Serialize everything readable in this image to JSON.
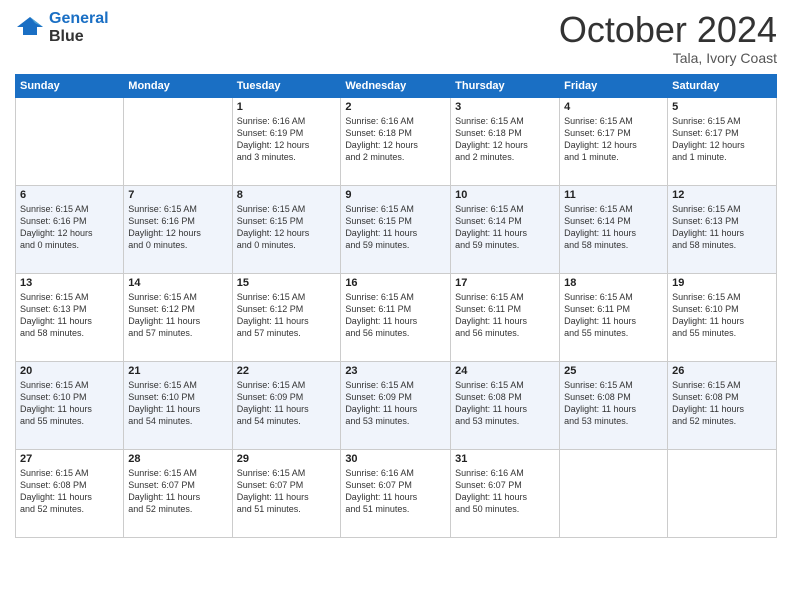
{
  "logo": {
    "line1": "General",
    "line2": "Blue"
  },
  "title": {
    "month_year": "October 2024",
    "location": "Tala, Ivory Coast"
  },
  "days_of_week": [
    "Sunday",
    "Monday",
    "Tuesday",
    "Wednesday",
    "Thursday",
    "Friday",
    "Saturday"
  ],
  "weeks": [
    [
      {
        "day": "",
        "info": ""
      },
      {
        "day": "",
        "info": ""
      },
      {
        "day": "1",
        "info": "Sunrise: 6:16 AM\nSunset: 6:19 PM\nDaylight: 12 hours\nand 3 minutes."
      },
      {
        "day": "2",
        "info": "Sunrise: 6:16 AM\nSunset: 6:18 PM\nDaylight: 12 hours\nand 2 minutes."
      },
      {
        "day": "3",
        "info": "Sunrise: 6:15 AM\nSunset: 6:18 PM\nDaylight: 12 hours\nand 2 minutes."
      },
      {
        "day": "4",
        "info": "Sunrise: 6:15 AM\nSunset: 6:17 PM\nDaylight: 12 hours\nand 1 minute."
      },
      {
        "day": "5",
        "info": "Sunrise: 6:15 AM\nSunset: 6:17 PM\nDaylight: 12 hours\nand 1 minute."
      }
    ],
    [
      {
        "day": "6",
        "info": "Sunrise: 6:15 AM\nSunset: 6:16 PM\nDaylight: 12 hours\nand 0 minutes."
      },
      {
        "day": "7",
        "info": "Sunrise: 6:15 AM\nSunset: 6:16 PM\nDaylight: 12 hours\nand 0 minutes."
      },
      {
        "day": "8",
        "info": "Sunrise: 6:15 AM\nSunset: 6:15 PM\nDaylight: 12 hours\nand 0 minutes."
      },
      {
        "day": "9",
        "info": "Sunrise: 6:15 AM\nSunset: 6:15 PM\nDaylight: 11 hours\nand 59 minutes."
      },
      {
        "day": "10",
        "info": "Sunrise: 6:15 AM\nSunset: 6:14 PM\nDaylight: 11 hours\nand 59 minutes."
      },
      {
        "day": "11",
        "info": "Sunrise: 6:15 AM\nSunset: 6:14 PM\nDaylight: 11 hours\nand 58 minutes."
      },
      {
        "day": "12",
        "info": "Sunrise: 6:15 AM\nSunset: 6:13 PM\nDaylight: 11 hours\nand 58 minutes."
      }
    ],
    [
      {
        "day": "13",
        "info": "Sunrise: 6:15 AM\nSunset: 6:13 PM\nDaylight: 11 hours\nand 58 minutes."
      },
      {
        "day": "14",
        "info": "Sunrise: 6:15 AM\nSunset: 6:12 PM\nDaylight: 11 hours\nand 57 minutes."
      },
      {
        "day": "15",
        "info": "Sunrise: 6:15 AM\nSunset: 6:12 PM\nDaylight: 11 hours\nand 57 minutes."
      },
      {
        "day": "16",
        "info": "Sunrise: 6:15 AM\nSunset: 6:11 PM\nDaylight: 11 hours\nand 56 minutes."
      },
      {
        "day": "17",
        "info": "Sunrise: 6:15 AM\nSunset: 6:11 PM\nDaylight: 11 hours\nand 56 minutes."
      },
      {
        "day": "18",
        "info": "Sunrise: 6:15 AM\nSunset: 6:11 PM\nDaylight: 11 hours\nand 55 minutes."
      },
      {
        "day": "19",
        "info": "Sunrise: 6:15 AM\nSunset: 6:10 PM\nDaylight: 11 hours\nand 55 minutes."
      }
    ],
    [
      {
        "day": "20",
        "info": "Sunrise: 6:15 AM\nSunset: 6:10 PM\nDaylight: 11 hours\nand 55 minutes."
      },
      {
        "day": "21",
        "info": "Sunrise: 6:15 AM\nSunset: 6:10 PM\nDaylight: 11 hours\nand 54 minutes."
      },
      {
        "day": "22",
        "info": "Sunrise: 6:15 AM\nSunset: 6:09 PM\nDaylight: 11 hours\nand 54 minutes."
      },
      {
        "day": "23",
        "info": "Sunrise: 6:15 AM\nSunset: 6:09 PM\nDaylight: 11 hours\nand 53 minutes."
      },
      {
        "day": "24",
        "info": "Sunrise: 6:15 AM\nSunset: 6:08 PM\nDaylight: 11 hours\nand 53 minutes."
      },
      {
        "day": "25",
        "info": "Sunrise: 6:15 AM\nSunset: 6:08 PM\nDaylight: 11 hours\nand 53 minutes."
      },
      {
        "day": "26",
        "info": "Sunrise: 6:15 AM\nSunset: 6:08 PM\nDaylight: 11 hours\nand 52 minutes."
      }
    ],
    [
      {
        "day": "27",
        "info": "Sunrise: 6:15 AM\nSunset: 6:08 PM\nDaylight: 11 hours\nand 52 minutes."
      },
      {
        "day": "28",
        "info": "Sunrise: 6:15 AM\nSunset: 6:07 PM\nDaylight: 11 hours\nand 52 minutes."
      },
      {
        "day": "29",
        "info": "Sunrise: 6:15 AM\nSunset: 6:07 PM\nDaylight: 11 hours\nand 51 minutes."
      },
      {
        "day": "30",
        "info": "Sunrise: 6:16 AM\nSunset: 6:07 PM\nDaylight: 11 hours\nand 51 minutes."
      },
      {
        "day": "31",
        "info": "Sunrise: 6:16 AM\nSunset: 6:07 PM\nDaylight: 11 hours\nand 50 minutes."
      },
      {
        "day": "",
        "info": ""
      },
      {
        "day": "",
        "info": ""
      }
    ]
  ]
}
